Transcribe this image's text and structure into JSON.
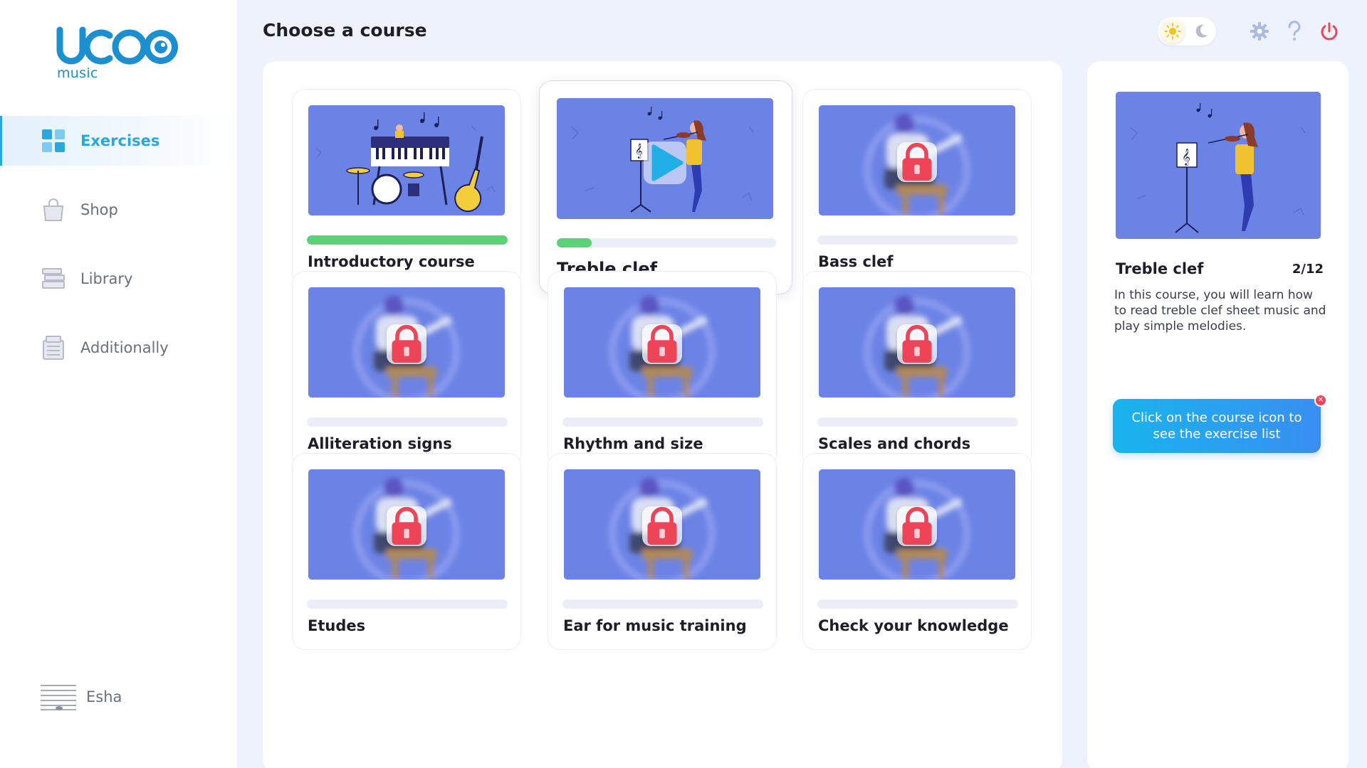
{
  "app": {
    "logo_sub": "music"
  },
  "sidebar": {
    "items": [
      {
        "label": "Exercises",
        "icon": "grid-icon",
        "active": true
      },
      {
        "label": "Shop",
        "icon": "shopping-bag-icon"
      },
      {
        "label": "Library",
        "icon": "books-icon"
      },
      {
        "label": "Additionally",
        "icon": "documents-icon"
      }
    ],
    "user": {
      "name": "Esha",
      "icon": "sheet-music-icon"
    }
  },
  "header": {
    "title": "Choose a course",
    "icons": [
      "sun-icon",
      "moon-icon",
      "gear-icon",
      "help-icon",
      "power-icon"
    ]
  },
  "courses": [
    {
      "title": "Introductory course",
      "progress": 1.0,
      "state": "completed",
      "illustration": "instruments"
    },
    {
      "title": "Treble clef",
      "progress": 0.16,
      "state": "in-progress",
      "illustration": "violinist"
    },
    {
      "title": "Bass clef",
      "progress": 0,
      "state": "locked"
    },
    {
      "title": "Alliteration signs",
      "progress": 0,
      "state": "locked"
    },
    {
      "title": "Rhythm and size",
      "progress": 0,
      "state": "locked"
    },
    {
      "title": "Scales and chords",
      "progress": 0,
      "state": "locked"
    },
    {
      "title": "Etudes",
      "progress": 0,
      "state": "locked"
    },
    {
      "title": "Ear for music training",
      "progress": 0,
      "state": "locked"
    },
    {
      "title": "Check your knowledge",
      "progress": 0,
      "state": "locked"
    }
  ],
  "details": {
    "title": "Treble clef",
    "count": "2/12",
    "description": "In this course, you will learn how to read treble clef sheet music and play simple melodies.",
    "hint": "Click on the course icon to see the exercise list"
  },
  "colors": {
    "accent": "#2aa7dd",
    "progress": "#5ad377",
    "thumb_bg": "#6c83e6",
    "lock": "#ee4458",
    "power": "#ee4458"
  }
}
